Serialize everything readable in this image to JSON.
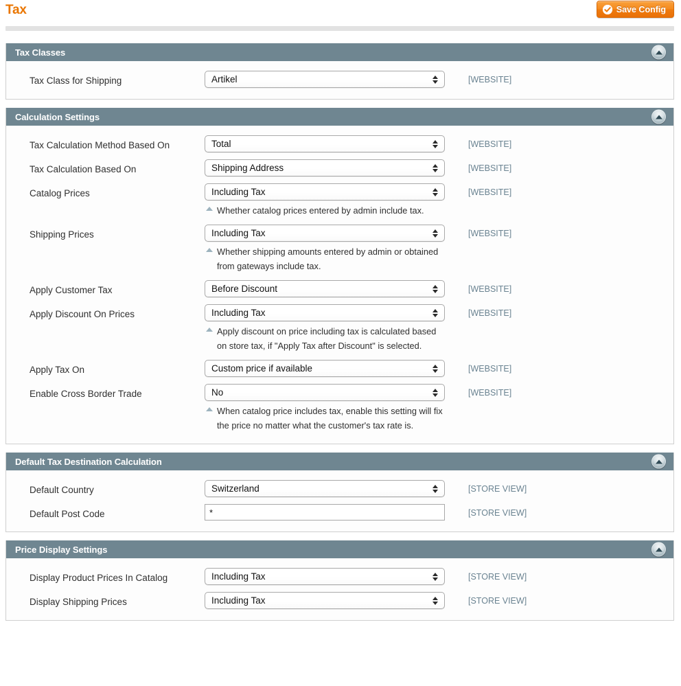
{
  "header": {
    "title": "Tax",
    "save_label": "Save Config",
    "save_icon": "check-circle-icon"
  },
  "scope_labels": {
    "website": "[WEBSITE]",
    "store_view": "[STORE VIEW]"
  },
  "collapse_icon": "collapse-up-icon",
  "sections": [
    {
      "id": "tax-classes",
      "title": "Tax Classes",
      "fields": [
        {
          "label": "Tax Class for Shipping",
          "type": "select",
          "value": "Artikel",
          "scope": "[WEBSITE]",
          "hint": ""
        }
      ]
    },
    {
      "id": "calculation-settings",
      "title": "Calculation Settings",
      "fields": [
        {
          "label": "Tax Calculation Method Based On",
          "type": "select",
          "value": "Total",
          "scope": "[WEBSITE]",
          "hint": ""
        },
        {
          "label": "Tax Calculation Based On",
          "type": "select",
          "value": "Shipping Address",
          "scope": "[WEBSITE]",
          "hint": ""
        },
        {
          "label": "Catalog Prices",
          "type": "select",
          "value": "Including Tax",
          "scope": "[WEBSITE]",
          "hint": "Whether catalog prices entered by admin include tax."
        },
        {
          "label": "Shipping Prices",
          "type": "select",
          "value": "Including Tax",
          "scope": "[WEBSITE]",
          "hint": "Whether shipping amounts entered by admin or obtained from gateways include tax."
        },
        {
          "label": "Apply Customer Tax",
          "type": "select",
          "value": "Before Discount",
          "scope": "[WEBSITE]",
          "hint": ""
        },
        {
          "label": "Apply Discount On Prices",
          "type": "select",
          "value": "Including Tax",
          "scope": "[WEBSITE]",
          "hint": "Apply discount on price including tax is calculated based on store tax, if \"Apply Tax after Discount\" is selected."
        },
        {
          "label": "Apply Tax On",
          "type": "select",
          "value": "Custom price if available",
          "scope": "[WEBSITE]",
          "hint": ""
        },
        {
          "label": "Enable Cross Border Trade",
          "type": "select",
          "value": "No",
          "scope": "[WEBSITE]",
          "hint": "When catalog price includes tax, enable this setting will fix the price no matter what the customer's tax rate is."
        }
      ]
    },
    {
      "id": "default-tax-destination-calculation",
      "title": "Default Tax Destination Calculation",
      "fields": [
        {
          "label": "Default Country",
          "type": "select",
          "value": "Switzerland",
          "scope": "[STORE VIEW]",
          "hint": ""
        },
        {
          "label": "Default Post Code",
          "type": "text",
          "value": "*",
          "scope": "[STORE VIEW]",
          "hint": ""
        }
      ]
    },
    {
      "id": "price-display-settings",
      "title": "Price Display Settings",
      "fields": [
        {
          "label": "Display Product Prices In Catalog",
          "type": "select",
          "value": "Including Tax",
          "scope": "[STORE VIEW]",
          "hint": ""
        },
        {
          "label": "Display Shipping Prices",
          "type": "select",
          "value": "Including Tax",
          "scope": "[STORE VIEW]",
          "hint": ""
        }
      ]
    }
  ]
}
